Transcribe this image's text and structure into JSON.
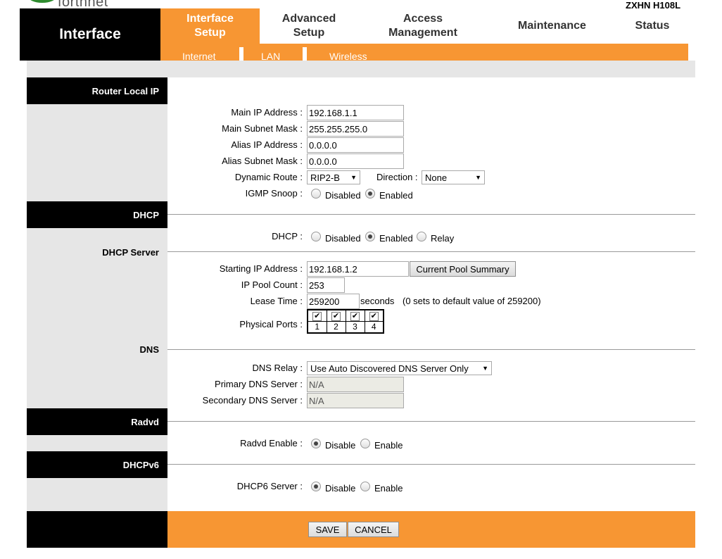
{
  "header": {
    "logo_text": "forthnet",
    "model": "ZXHN H108L",
    "brand_box": "Interface",
    "tabs": [
      {
        "label_line1": "Interface",
        "label_line2": "Setup"
      },
      {
        "label_line1": "Advanced",
        "label_line2": "Setup"
      },
      {
        "label_line1": "Access",
        "label_line2": "Management"
      },
      {
        "label_line1": "Maintenance",
        "label_line2": ""
      },
      {
        "label_line1": "Status",
        "label_line2": ""
      }
    ],
    "subtabs": [
      "Internet",
      "LAN",
      "Wireless"
    ]
  },
  "sections": {
    "router_local_ip": "Router Local IP",
    "dhcp": "DHCP",
    "dhcp_server": "DHCP Server",
    "dns": "DNS",
    "radvd": "Radvd",
    "dhcpv6": "DHCPv6"
  },
  "router": {
    "main_ip_label": "Main IP Address :",
    "main_ip_value": "192.168.1.1",
    "main_mask_label": "Main Subnet Mask :",
    "main_mask_value": "255.255.255.0",
    "alias_ip_label": "Alias IP Address :",
    "alias_ip_value": "0.0.0.0",
    "alias_mask_label": "Alias Subnet Mask :",
    "alias_mask_value": "0.0.0.0",
    "dynamic_route_label": "Dynamic Route :",
    "dynamic_route_value": "RIP2-B",
    "direction_label": "Direction :",
    "direction_value": "None",
    "igmp_label": "IGMP Snoop :",
    "igmp_disabled": "Disabled",
    "igmp_enabled": "Enabled"
  },
  "dhcp": {
    "dhcp_label": "DHCP :",
    "opt_disabled": "Disabled",
    "opt_enabled": "Enabled",
    "opt_relay": "Relay",
    "start_ip_label": "Starting IP Address :",
    "start_ip_value": "192.168.1.2",
    "pool_summary_button": "Current Pool Summary",
    "pool_count_label": "IP Pool Count :",
    "pool_count_value": "253",
    "lease_label": "Lease Time :",
    "lease_value": "259200",
    "lease_unit": "seconds",
    "lease_note": "(0 sets to default value of 259200)",
    "ports_label": "Physical Ports :",
    "ports": [
      "1",
      "2",
      "3",
      "4"
    ],
    "check_glyph": "✔"
  },
  "dns": {
    "relay_label": "DNS Relay :",
    "relay_value": "Use Auto Discovered DNS Server Only",
    "primary_label": "Primary DNS Server :",
    "primary_value": "N/A",
    "secondary_label": "Secondary DNS Server :",
    "secondary_value": "N/A"
  },
  "radvd": {
    "enable_label": "Radvd Enable :",
    "opt_disable": "Disable",
    "opt_enable": "Enable"
  },
  "dhcpv6": {
    "server_label": "DHCP6 Server :",
    "opt_disable": "Disable",
    "opt_enable": "Enable"
  },
  "footer": {
    "save": "SAVE",
    "cancel": "CANCEL"
  },
  "colors": {
    "accent": "#f79633",
    "header_black": "#000000",
    "panel_gray": "#e6e6e6"
  }
}
